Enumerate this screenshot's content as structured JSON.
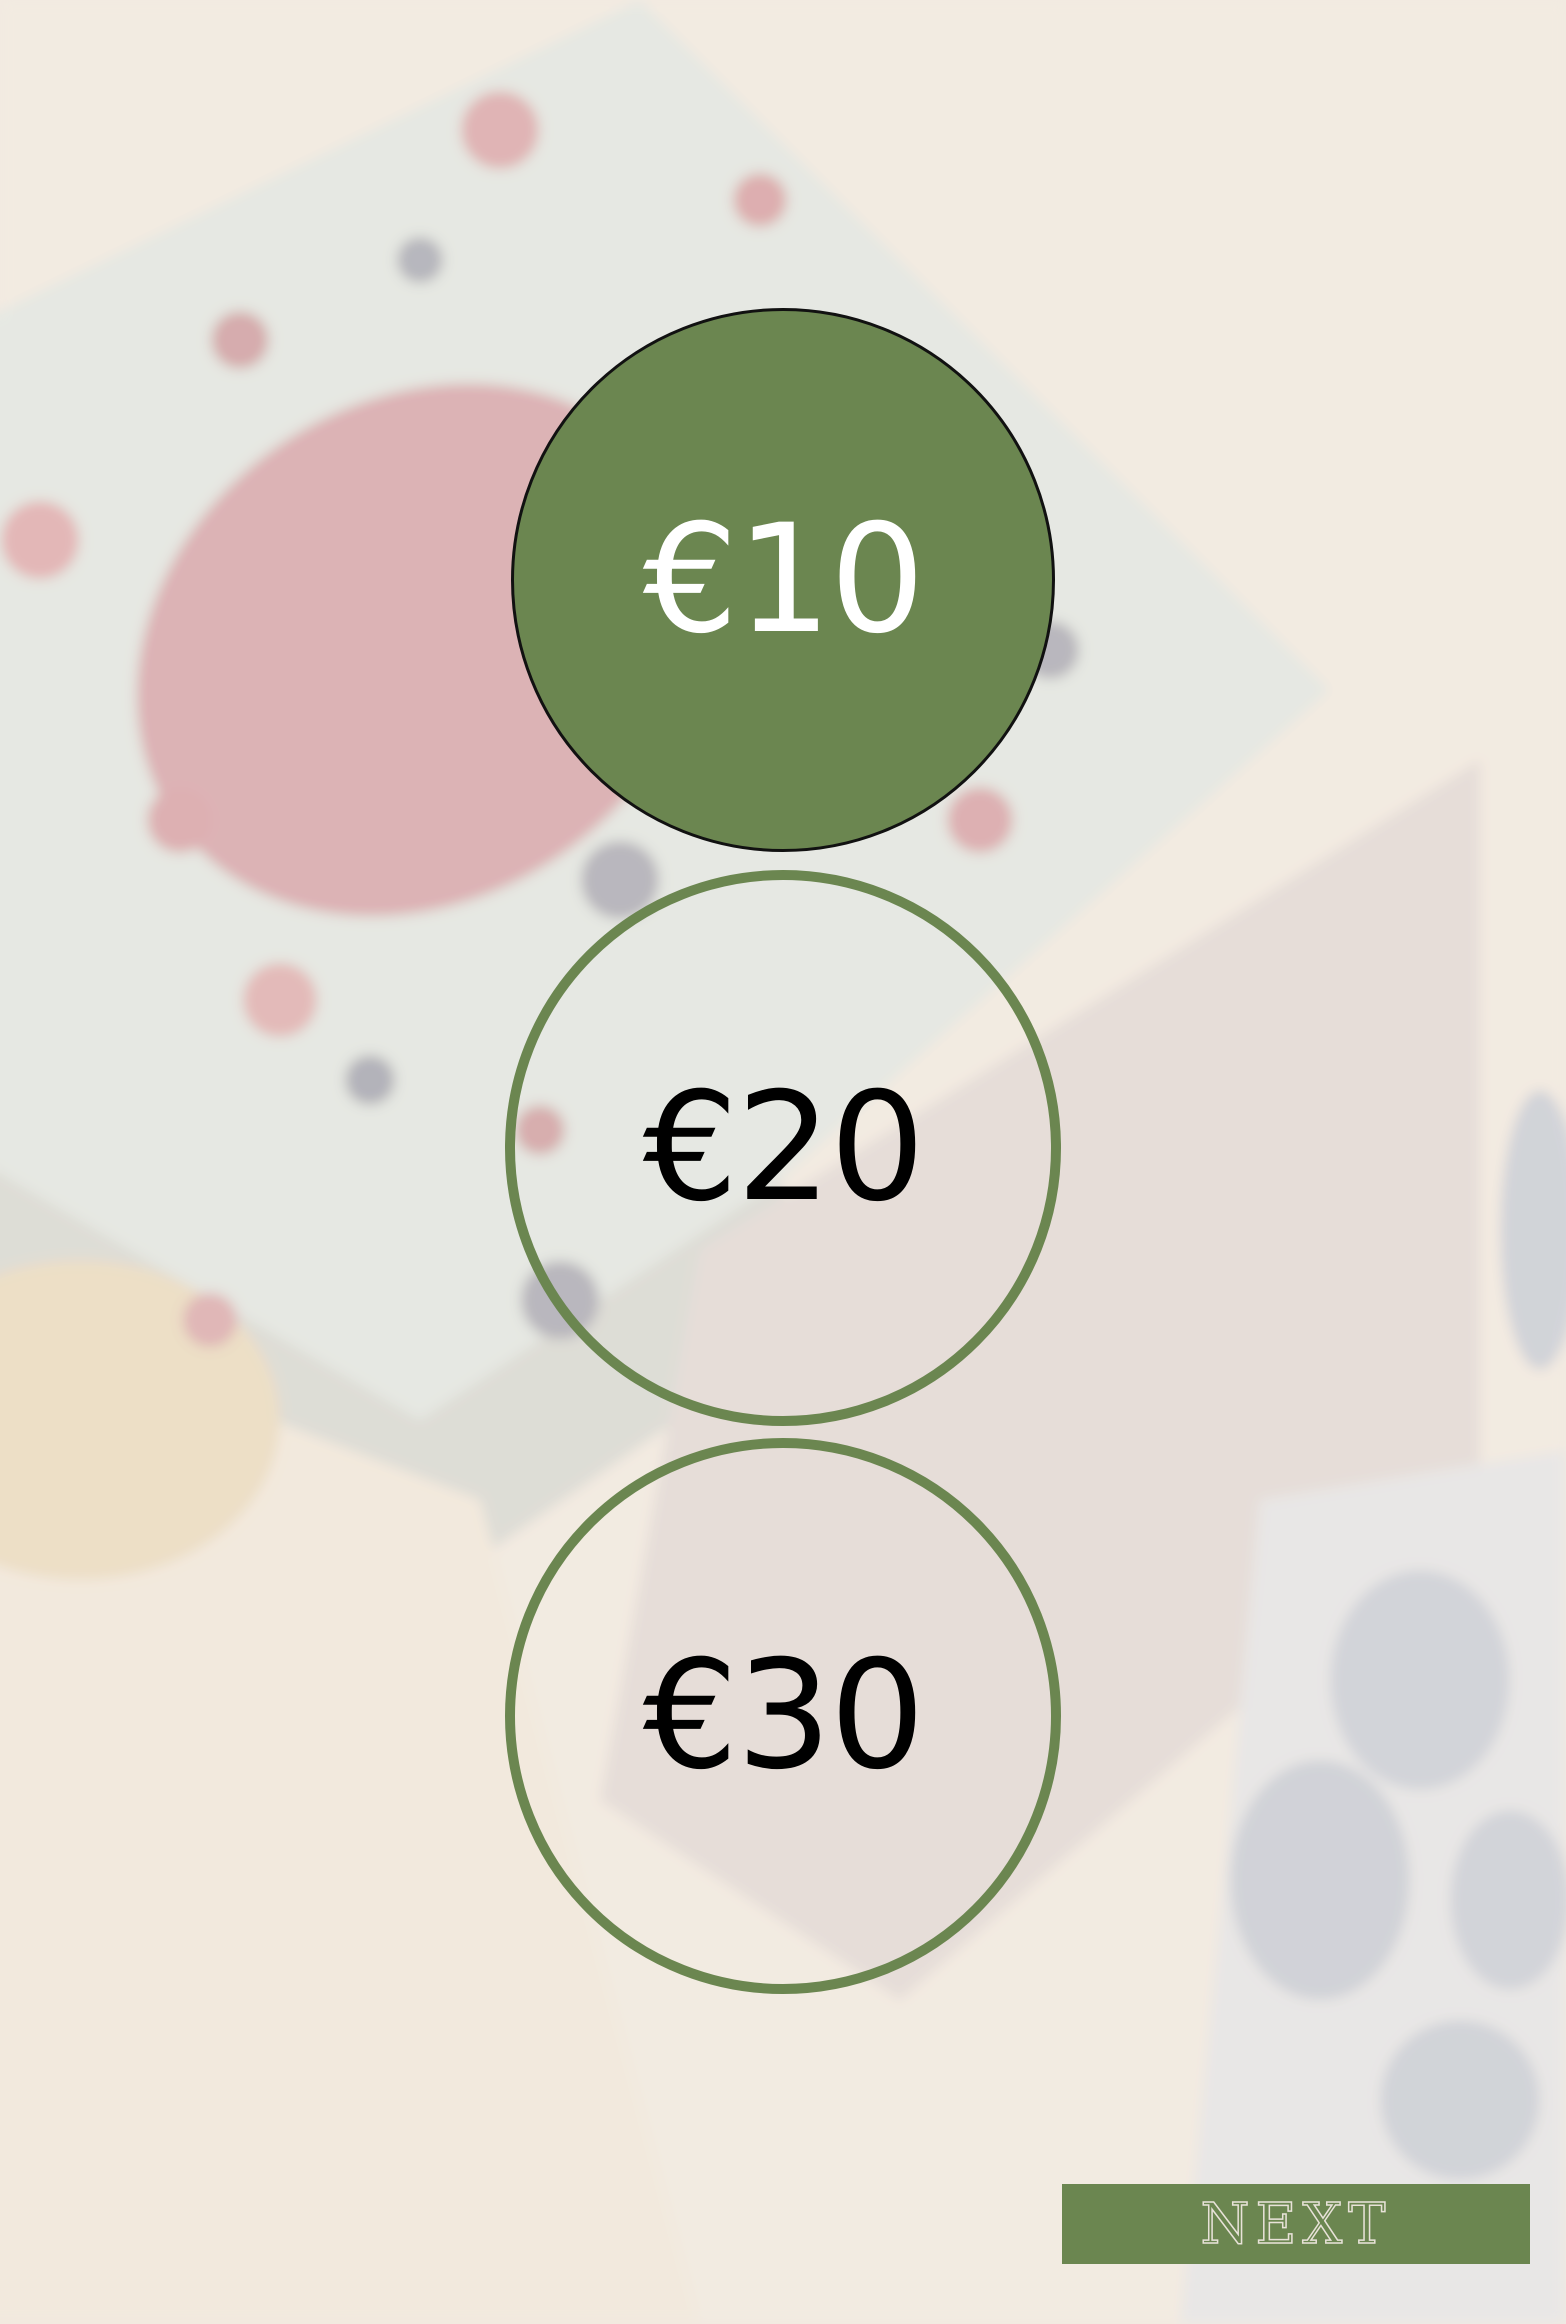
{
  "amount_options": [
    {
      "label": "€10",
      "selected": true
    },
    {
      "label": "€20",
      "selected": false
    },
    {
      "label": "€30",
      "selected": false
    }
  ],
  "next_label": "NEXT",
  "colors": {
    "accent": "#6b8650",
    "selected_text": "#ffffff",
    "unselected_text": "#000000"
  },
  "background": "blurred photo of frozen summer fruit and cereal packages"
}
